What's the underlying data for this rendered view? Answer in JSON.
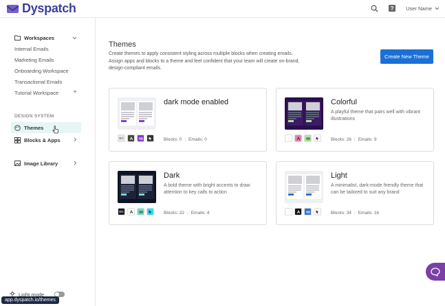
{
  "app": {
    "brand": "Dyspatch",
    "brand_color": "#3b3f9a"
  },
  "topbar": {
    "user_name": "User Name"
  },
  "sidebar": {
    "workspaces_label": "Workspaces",
    "workspaces": [
      "Internal Emails",
      "Marketing Emails",
      "Onboarding Workspace",
      "Transactional Emails",
      "Tutorial Workspace"
    ],
    "design_system_label": "DESIGN SYSTEM",
    "themes_label": "Themes",
    "blocks_apps_label": "Blocks & Apps",
    "image_library_label": "Image Library",
    "light_mode_label": "Light mode",
    "url_tooltip": "app.dyspatch.io/themes"
  },
  "main": {
    "title": "Themes",
    "description": "Create themes to apply consistent styling across multiple blocks when creating emails. Assign apps and blocks to a theme and feel confident that your team will create on-brand, design-compliant emails.",
    "new_theme_button": "Create New Theme"
  },
  "themes": [
    {
      "name": "dark mode enabled",
      "description": "",
      "blocks": "Blocks: 0",
      "emails": "Emails: 0",
      "dark": false,
      "colors": [
        "#e8e8e8",
        "#444444",
        "#7d3fd0",
        "#333333"
      ],
      "swatch_labels": [
        "BG",
        "",
        "",
        ""
      ]
    },
    {
      "name": "Colorful",
      "description": "A playful theme that pairs well with vibrant illustrations",
      "blocks": "Blocks: 26",
      "emails": "Emails: 9",
      "dark": true,
      "colors": [
        "#ffffff",
        "#f07ab4",
        "#a8e6a0",
        "#ffffff"
      ],
      "swatch_labels": [
        "",
        "",
        "",
        ""
      ]
    },
    {
      "name": "Dark",
      "description": "A bold theme with bright accents to draw attention to key calls to action",
      "blocks": "Blocks: 32",
      "emails": "Emails: 4",
      "dark": true,
      "colors": [
        "#1a1a2a",
        "#ffffff",
        "#6ee0c8",
        "#25e0f0"
      ],
      "swatch_labels": [
        "BG",
        "",
        "",
        ""
      ]
    },
    {
      "name": "Light",
      "description": "A minimalist, dark-mode friendly theme that can be tailored to suit any brand",
      "blocks": "Blocks: 34",
      "emails": "Emails: 16",
      "dark": false,
      "colors": [
        "#ffffff",
        "#111111",
        "#2d6fd6",
        "#ffffff"
      ],
      "swatch_labels": [
        "",
        "",
        "",
        ""
      ]
    }
  ]
}
